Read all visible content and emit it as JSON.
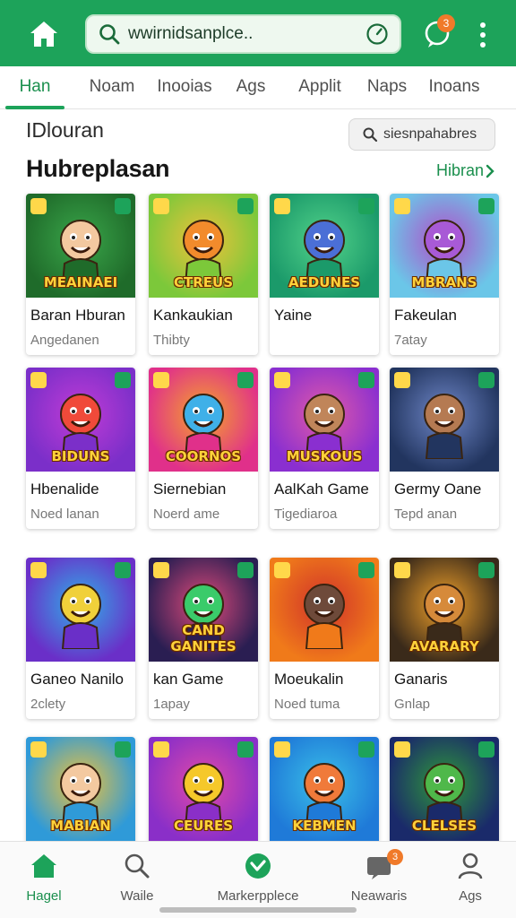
{
  "topbar": {
    "search_value": "wwirnidsanplce..",
    "notification_count": "3",
    "icons": [
      "home-icon",
      "search-icon",
      "check-circle-icon",
      "notification-icon",
      "more-vert-icon"
    ]
  },
  "tabs": [
    {
      "label": "Han",
      "active": true
    },
    {
      "label": "Noam"
    },
    {
      "label": "Inooias"
    },
    {
      "label": "Ags"
    },
    {
      "label": "Applit"
    },
    {
      "label": "Naps"
    },
    {
      "label": "Inoans"
    }
  ],
  "category": {
    "label": "IDlouran",
    "chip_label": "siesnpahabres"
  },
  "section": {
    "title": "Hubreplasan",
    "see_all": "Hibran"
  },
  "games": [
    {
      "title": "Baran Hburan",
      "sub": "Angedanen",
      "art_text": "MEAINAEI",
      "bg1": "#1f6b2a",
      "bg2": "#3aa64a",
      "face": "#f3c9a0"
    },
    {
      "title": "Kankaukian",
      "sub": "Thibty",
      "art_text": "CTREUS",
      "bg1": "#7cc83a",
      "bg2": "#f0c23a",
      "face": "#f28b2c"
    },
    {
      "title": "Yaine",
      "sub": "",
      "art_text": "AEDUNES",
      "bg1": "#1b9a6a",
      "bg2": "#52d28a",
      "face": "#4b6fd6"
    },
    {
      "title": "Fakeulan",
      "sub": "7atay",
      "art_text": "MBRANS",
      "bg1": "#6bc6e8",
      "bg2": "#b24cc8",
      "face": "#a85ad6"
    },
    {
      "title": "Hbenalide",
      "sub": "Noed lanan",
      "art_text": "BIDUNS",
      "bg1": "#7b2fc9",
      "bg2": "#c13cd6",
      "face": "#f04a3a"
    },
    {
      "title": "Siernebian",
      "sub": "Noerd ame",
      "art_text": "COORNOS",
      "bg1": "#e0308a",
      "bg2": "#f5a52a",
      "face": "#3fb0e8"
    },
    {
      "title": "AalKah Game",
      "sub": "Tigediaroa",
      "art_text": "MUSKOUS",
      "bg1": "#8a2fd0",
      "bg2": "#e25aa8",
      "face": "#c0855a"
    },
    {
      "title": "Germy Oane",
      "sub": "Tepd anan",
      "art_text": "",
      "bg1": "#22355f",
      "bg2": "#6f87c8",
      "face": "#b57a52"
    },
    {
      "title": "Ganeo Nanilo",
      "sub": "2clety",
      "art_text": "",
      "bg1": "#6a2fc8",
      "bg2": "#2fb0e8",
      "face": "#f0d03a"
    },
    {
      "title": "kan Game",
      "sub": "1apay",
      "art_text": "CAND GANITES",
      "bg1": "#2a1e52",
      "bg2": "#e04a7a",
      "face": "#3acb6a"
    },
    {
      "title": "Moeukalin",
      "sub": "Noed tuma",
      "art_text": "",
      "bg1": "#f07a1a",
      "bg2": "#d0322a",
      "face": "#6e4a3a"
    },
    {
      "title": "Ganaris",
      "sub": "Gnlap",
      "art_text": "AVARARY",
      "bg1": "#3a2a1a",
      "bg2": "#f2a22a",
      "face": "#d68a3a"
    },
    {
      "title": "",
      "sub": "",
      "art_text": "MABIAN",
      "bg1": "#2f9ad8",
      "bg2": "#f0c23a",
      "face": "#f3c9a0"
    },
    {
      "title": "",
      "sub": "",
      "art_text": "CEURES",
      "bg1": "#8a2fc8",
      "bg2": "#e24aa8",
      "face": "#f5c82a"
    },
    {
      "title": "",
      "sub": "",
      "art_text": "KEBMEN",
      "bg1": "#1f7ad8",
      "bg2": "#3ac0e8",
      "face": "#f07a3a"
    },
    {
      "title": "",
      "sub": "",
      "art_text": "CLELSES",
      "bg1": "#1a2a6a",
      "bg2": "#2f9a3a",
      "face": "#4fb84a"
    }
  ],
  "bottom_nav": [
    {
      "label": "Hagel",
      "icon": "home-icon",
      "active": true
    },
    {
      "label": "Waile",
      "icon": "search-icon"
    },
    {
      "label": "Markerpplece",
      "icon": "marketplace-check-icon"
    },
    {
      "label": "Neawaris",
      "icon": "news-icon",
      "badge": "3"
    },
    {
      "label": "Ags",
      "icon": "profile-icon"
    }
  ],
  "colors": {
    "brand_green": "#1da35a",
    "accent_orange": "#f07a2a"
  }
}
